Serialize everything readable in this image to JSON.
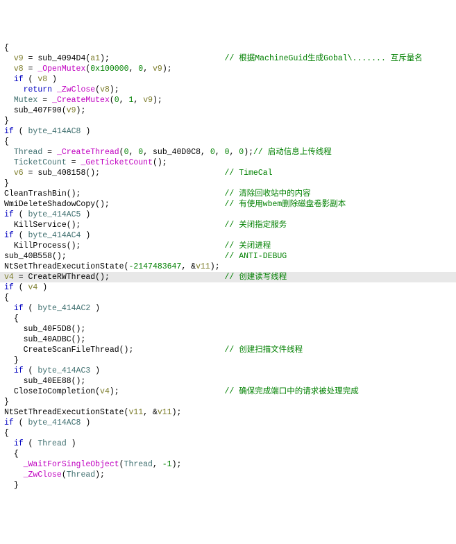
{
  "code": {
    "lines": [
      {
        "indent": 0,
        "segs": [
          [
            "br",
            "{"
          ]
        ]
      },
      {
        "indent": 1,
        "segs": [
          [
            "var-loc",
            "v9"
          ],
          [
            "op",
            " = "
          ],
          [
            "fn-user",
            "sub_4094D4"
          ],
          [
            "br",
            "("
          ],
          [
            "var-param",
            "a1"
          ],
          [
            "br",
            ");"
          ],
          [
            "pad",
            "                        "
          ],
          [
            "cmt",
            "// 根据MachineGuid生成Gobal\\....... 互斥量名"
          ]
        ]
      },
      {
        "indent": 1,
        "segs": [
          [
            "var-loc",
            "v8"
          ],
          [
            "op",
            " = "
          ],
          [
            "fn-api",
            "_OpenMutex"
          ],
          [
            "br",
            "("
          ],
          [
            "num",
            "0x100000"
          ],
          [
            "op",
            ", "
          ],
          [
            "num",
            "0"
          ],
          [
            "op",
            ", "
          ],
          [
            "var-loc",
            "v9"
          ],
          [
            "br",
            ");"
          ]
        ]
      },
      {
        "indent": 1,
        "segs": [
          [
            "kw",
            "if"
          ],
          [
            "op",
            " ( "
          ],
          [
            "var-loc",
            "v8"
          ],
          [
            "op",
            " )"
          ]
        ]
      },
      {
        "indent": 2,
        "segs": [
          [
            "kw",
            "return"
          ],
          [
            "op",
            " "
          ],
          [
            "fn-api",
            "_ZwClose"
          ],
          [
            "br",
            "("
          ],
          [
            "var-loc",
            "v8"
          ],
          [
            "br",
            ");"
          ]
        ]
      },
      {
        "indent": 1,
        "segs": [
          [
            "var-glob",
            "Mutex"
          ],
          [
            "op",
            " = "
          ],
          [
            "fn-api",
            "_CreateMutex"
          ],
          [
            "br",
            "("
          ],
          [
            "num",
            "0"
          ],
          [
            "op",
            ", "
          ],
          [
            "num",
            "1"
          ],
          [
            "op",
            ", "
          ],
          [
            "var-loc",
            "v9"
          ],
          [
            "br",
            ");"
          ]
        ]
      },
      {
        "indent": 1,
        "segs": [
          [
            "fn-user",
            "sub_407F90"
          ],
          [
            "br",
            "("
          ],
          [
            "var-loc",
            "v9"
          ],
          [
            "br",
            ");"
          ]
        ]
      },
      {
        "indent": 0,
        "segs": [
          [
            "br",
            "}"
          ]
        ]
      },
      {
        "indent": 0,
        "segs": [
          [
            "kw",
            "if"
          ],
          [
            "op",
            " ( "
          ],
          [
            "var-glob",
            "byte_414AC8"
          ],
          [
            "op",
            " )"
          ]
        ]
      },
      {
        "indent": 0,
        "segs": [
          [
            "br",
            "{"
          ]
        ]
      },
      {
        "indent": 1,
        "segs": [
          [
            "var-glob",
            "Thread"
          ],
          [
            "op",
            " = "
          ],
          [
            "fn-api",
            "_CreateThread"
          ],
          [
            "br",
            "("
          ],
          [
            "num",
            "0"
          ],
          [
            "op",
            ", "
          ],
          [
            "num",
            "0"
          ],
          [
            "op",
            ", "
          ],
          [
            "fn-user",
            "sub_40D0C8"
          ],
          [
            "op",
            ", "
          ],
          [
            "num",
            "0"
          ],
          [
            "op",
            ", "
          ],
          [
            "num",
            "0"
          ],
          [
            "op",
            ", "
          ],
          [
            "num",
            "0"
          ],
          [
            "br",
            ");"
          ],
          [
            "cmt",
            "// 启动信息上传线程"
          ]
        ]
      },
      {
        "indent": 1,
        "segs": [
          [
            "var-glob",
            "TicketCount"
          ],
          [
            "op",
            " = "
          ],
          [
            "fn-api",
            "_GetTicketCount"
          ],
          [
            "br",
            "();"
          ]
        ]
      },
      {
        "indent": 1,
        "segs": [
          [
            "var-loc",
            "v6"
          ],
          [
            "op",
            " = "
          ],
          [
            "fn-user",
            "sub_408158"
          ],
          [
            "br",
            "();"
          ],
          [
            "pad",
            "                          "
          ],
          [
            "cmt",
            "// TimeCal"
          ]
        ]
      },
      {
        "indent": 0,
        "segs": [
          [
            "br",
            "}"
          ]
        ]
      },
      {
        "indent": 0,
        "segs": [
          [
            "fn-user",
            "CleanTrashBin"
          ],
          [
            "br",
            "();"
          ],
          [
            "pad",
            "                              "
          ],
          [
            "cmt",
            "// 清除回收站中的内容"
          ]
        ]
      },
      {
        "indent": 0,
        "segs": [
          [
            "fn-user",
            "WmiDeleteShadowCopy"
          ],
          [
            "br",
            "();"
          ],
          [
            "pad",
            "                        "
          ],
          [
            "cmt",
            "// 有使用wbem删除磁盘卷影副本"
          ]
        ]
      },
      {
        "indent": 0,
        "segs": [
          [
            "kw",
            "if"
          ],
          [
            "op",
            " ( "
          ],
          [
            "var-glob",
            "byte_414AC5"
          ],
          [
            "op",
            " )"
          ]
        ]
      },
      {
        "indent": 1,
        "segs": [
          [
            "fn-user",
            "KillService"
          ],
          [
            "br",
            "();"
          ],
          [
            "pad",
            "                              "
          ],
          [
            "cmt",
            "// 关闭指定服务"
          ]
        ]
      },
      {
        "indent": 0,
        "segs": [
          [
            "kw",
            "if"
          ],
          [
            "op",
            " ( "
          ],
          [
            "var-glob",
            "byte_414AC4"
          ],
          [
            "op",
            " )"
          ]
        ]
      },
      {
        "indent": 1,
        "segs": [
          [
            "fn-user",
            "KillProcess"
          ],
          [
            "br",
            "();"
          ],
          [
            "pad",
            "                              "
          ],
          [
            "cmt",
            "// 关闭进程"
          ]
        ]
      },
      {
        "indent": 0,
        "segs": [
          [
            "fn-user",
            "sub_40B558"
          ],
          [
            "br",
            "();"
          ],
          [
            "pad",
            "                                 "
          ],
          [
            "cmt",
            "// ANTI-DEBUG"
          ]
        ]
      },
      {
        "indent": 0,
        "segs": [
          [
            "fn-user",
            "NtSetThreadExecutionState"
          ],
          [
            "br",
            "("
          ],
          [
            "num",
            "-2147483647"
          ],
          [
            "op",
            ", &"
          ],
          [
            "var-loc",
            "v11"
          ],
          [
            "br",
            ");"
          ]
        ]
      },
      {
        "indent": 0,
        "hl": true,
        "segs": [
          [
            "var-loc",
            "v4"
          ],
          [
            "op",
            " = "
          ],
          [
            "fn-user",
            "CreateRWThread"
          ],
          [
            "br",
            "();"
          ],
          [
            "pad",
            "                        "
          ],
          [
            "cmt",
            "// 创建读写线程"
          ]
        ]
      },
      {
        "indent": 0,
        "segs": [
          [
            "kw",
            "if"
          ],
          [
            "op",
            " ( "
          ],
          [
            "var-loc",
            "v4"
          ],
          [
            "op",
            " )"
          ]
        ]
      },
      {
        "indent": 0,
        "segs": [
          [
            "br",
            "{"
          ]
        ]
      },
      {
        "indent": 1,
        "segs": [
          [
            "kw",
            "if"
          ],
          [
            "op",
            " ( "
          ],
          [
            "var-glob",
            "byte_414AC2"
          ],
          [
            "op",
            " )"
          ]
        ]
      },
      {
        "indent": 1,
        "segs": [
          [
            "br",
            "{"
          ]
        ]
      },
      {
        "indent": 2,
        "segs": [
          [
            "fn-user",
            "sub_40F5D8"
          ],
          [
            "br",
            "();"
          ]
        ]
      },
      {
        "indent": 2,
        "segs": [
          [
            "fn-user",
            "sub_40ADBC"
          ],
          [
            "br",
            "();"
          ]
        ]
      },
      {
        "indent": 2,
        "segs": [
          [
            "fn-user",
            "CreateScanFileThread"
          ],
          [
            "br",
            "();"
          ],
          [
            "pad",
            "                   "
          ],
          [
            "cmt",
            "// 创建扫描文件线程"
          ]
        ]
      },
      {
        "indent": 1,
        "segs": [
          [
            "br",
            "}"
          ]
        ]
      },
      {
        "indent": 1,
        "segs": [
          [
            "kw",
            "if"
          ],
          [
            "op",
            " ( "
          ],
          [
            "var-glob",
            "byte_414AC3"
          ],
          [
            "op",
            " )"
          ]
        ]
      },
      {
        "indent": 2,
        "segs": [
          [
            "fn-user",
            "sub_40EE88"
          ],
          [
            "br",
            "();"
          ]
        ]
      },
      {
        "indent": 1,
        "segs": [
          [
            "fn-user",
            "CloseIoCompletion"
          ],
          [
            "br",
            "("
          ],
          [
            "var-loc",
            "v4"
          ],
          [
            "br",
            ");"
          ],
          [
            "pad",
            "                      "
          ],
          [
            "cmt",
            "// 确保完成端口中的请求被处理完成"
          ]
        ]
      },
      {
        "indent": 0,
        "segs": [
          [
            "br",
            "}"
          ]
        ]
      },
      {
        "indent": 0,
        "segs": [
          [
            "fn-user",
            "NtSetThreadExecutionState"
          ],
          [
            "br",
            "("
          ],
          [
            "var-loc",
            "v11"
          ],
          [
            "op",
            ", &"
          ],
          [
            "var-loc",
            "v11"
          ],
          [
            "br",
            ");"
          ]
        ]
      },
      {
        "indent": 0,
        "segs": [
          [
            "kw",
            "if"
          ],
          [
            "op",
            " ( "
          ],
          [
            "var-glob",
            "byte_414AC8"
          ],
          [
            "op",
            " )"
          ]
        ]
      },
      {
        "indent": 0,
        "segs": [
          [
            "br",
            "{"
          ]
        ]
      },
      {
        "indent": 1,
        "segs": [
          [
            "kw",
            "if"
          ],
          [
            "op",
            " ( "
          ],
          [
            "var-glob",
            "Thread"
          ],
          [
            "op",
            " )"
          ]
        ]
      },
      {
        "indent": 1,
        "segs": [
          [
            "br",
            "{"
          ]
        ]
      },
      {
        "indent": 2,
        "segs": [
          [
            "fn-api",
            "_WaitForSingleObject"
          ],
          [
            "br",
            "("
          ],
          [
            "var-glob",
            "Thread"
          ],
          [
            "op",
            ", "
          ],
          [
            "num",
            "-1"
          ],
          [
            "br",
            ");"
          ]
        ]
      },
      {
        "indent": 2,
        "segs": [
          [
            "fn-api",
            "_ZwClose"
          ],
          [
            "br",
            "("
          ],
          [
            "var-glob",
            "Thread"
          ],
          [
            "br",
            ");"
          ]
        ]
      },
      {
        "indent": 1,
        "segs": [
          [
            "br",
            "}"
          ]
        ]
      }
    ]
  }
}
